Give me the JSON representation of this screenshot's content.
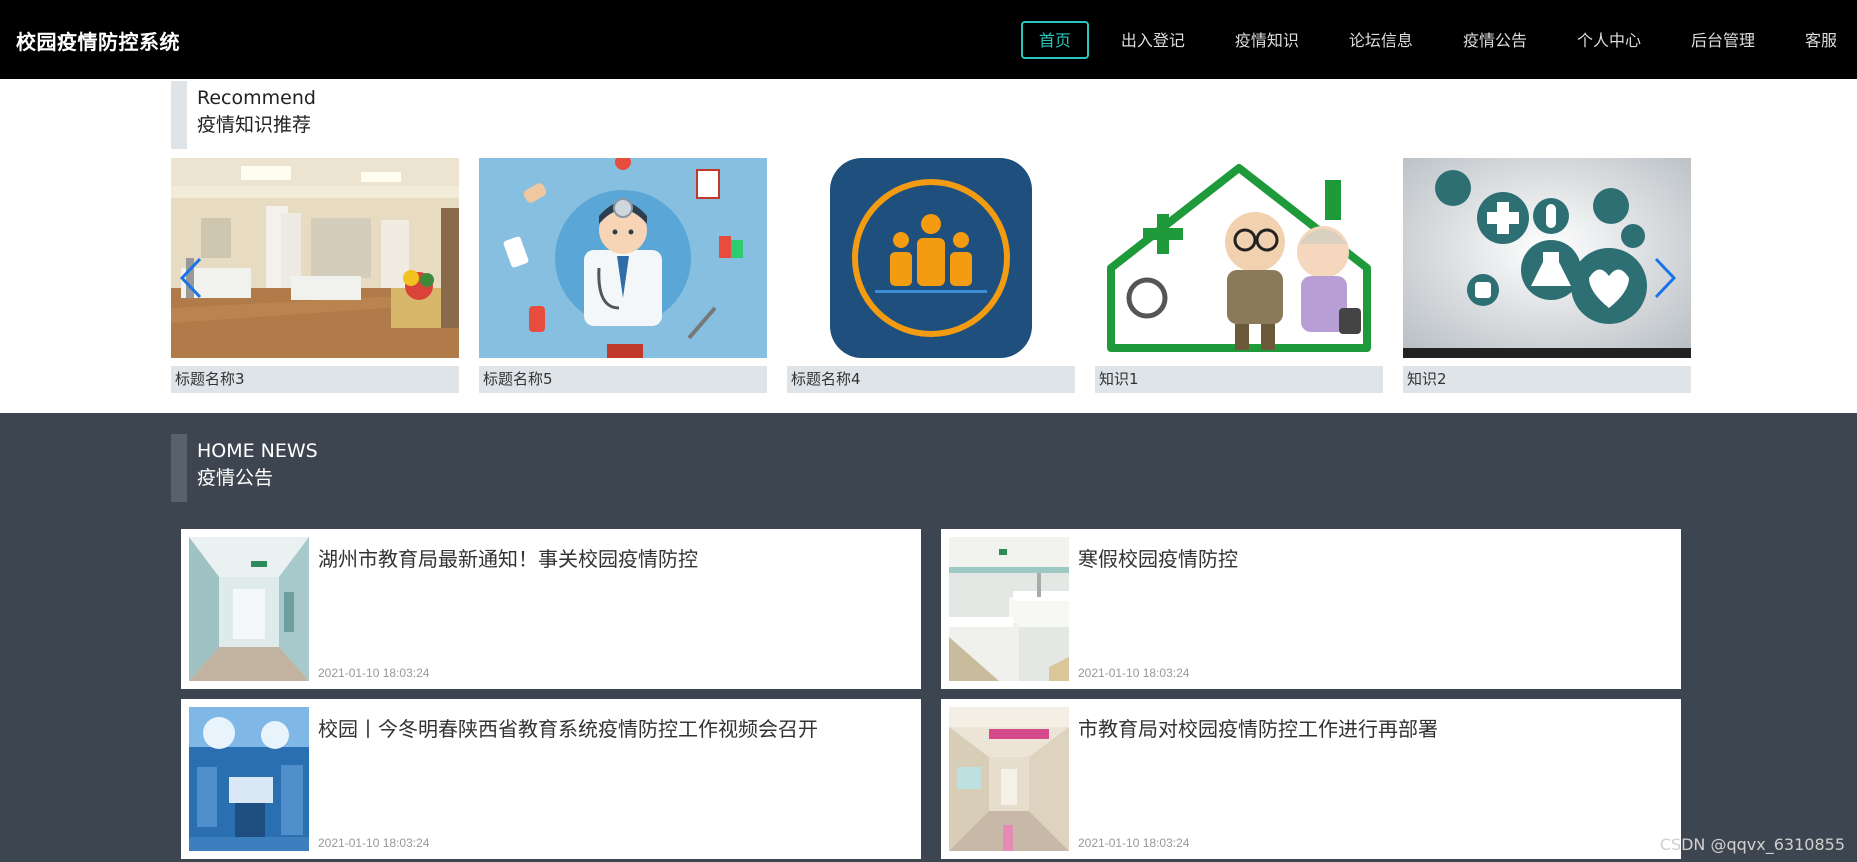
{
  "header": {
    "brand": "校园疫情防控系统",
    "nav": [
      "首页",
      "出入登记",
      "疫情知识",
      "论坛信息",
      "疫情公告",
      "个人中心",
      "后台管理",
      "客服"
    ],
    "active_index": 0
  },
  "recommend": {
    "title_en": "Recommend",
    "title_cn": "疫情知识推荐",
    "cards": [
      {
        "caption": "标题名称3",
        "image": "hospital-ward-photo"
      },
      {
        "caption": "标题名称5",
        "image": "doctor-illustration"
      },
      {
        "caption": "标题名称4",
        "image": "medical-team-icon"
      },
      {
        "caption": "知识1",
        "image": "elderly-couple-home-care"
      },
      {
        "caption": "知识2",
        "image": "medical-icons-graphic"
      }
    ],
    "prev_icon": "chevron-left-icon",
    "next_icon": "chevron-right-icon"
  },
  "news": {
    "title_en": "HOME NEWS",
    "title_cn": "疫情公告",
    "items": [
      {
        "title": "湖州市教育局最新通知！事关校园疫情防控",
        "time": "2021-01-10 18:03:24",
        "image": "hospital-corridor-photo"
      },
      {
        "title": "寒假校园疫情防控",
        "time": "2021-01-10 18:03:24",
        "image": "hospital-room-photo"
      },
      {
        "title": "校园丨今冬明春陕西省教育系统疫情防控工作视频会召开",
        "time": "2021-01-10 18:03:24",
        "image": "operating-room-photo"
      },
      {
        "title": "市教育局对校园疫情防控工作进行再部署",
        "time": "2021-01-10 18:03:24",
        "image": "clinic-hallway-photo"
      }
    ]
  },
  "watermark": "CSDN @qqvx_6310855",
  "colors": {
    "accent": "#2ac6bc",
    "header_bg": "#000000",
    "news_bg": "#3d4650",
    "caption_bg": "#dfe4e9",
    "arrow": "#1a73e8"
  }
}
